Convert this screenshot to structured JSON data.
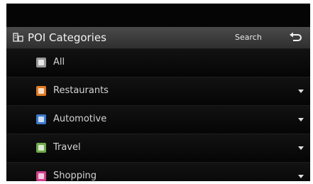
{
  "header": {
    "title": "POI Categories",
    "search_label": "Search",
    "title_icon": "poi-categories-icon",
    "back_icon": "back-arrow-icon"
  },
  "colors": {
    "background": "#050505",
    "header": "#3c3c3c",
    "text": "#d4d4d4"
  },
  "categories": [
    {
      "label": "All",
      "icon": "all-icon",
      "color": "#9a9a9a",
      "expandable": false
    },
    {
      "label": "Restaurants",
      "icon": "restaurants-icon",
      "color": "#e07a22",
      "expandable": true
    },
    {
      "label": "Automotive",
      "icon": "automotive-icon",
      "color": "#3b78c8",
      "expandable": true
    },
    {
      "label": "Travel",
      "icon": "travel-icon",
      "color": "#6fa84a",
      "expandable": true
    },
    {
      "label": "Shopping",
      "icon": "shopping-icon",
      "color": "#d0408a",
      "expandable": true
    }
  ]
}
